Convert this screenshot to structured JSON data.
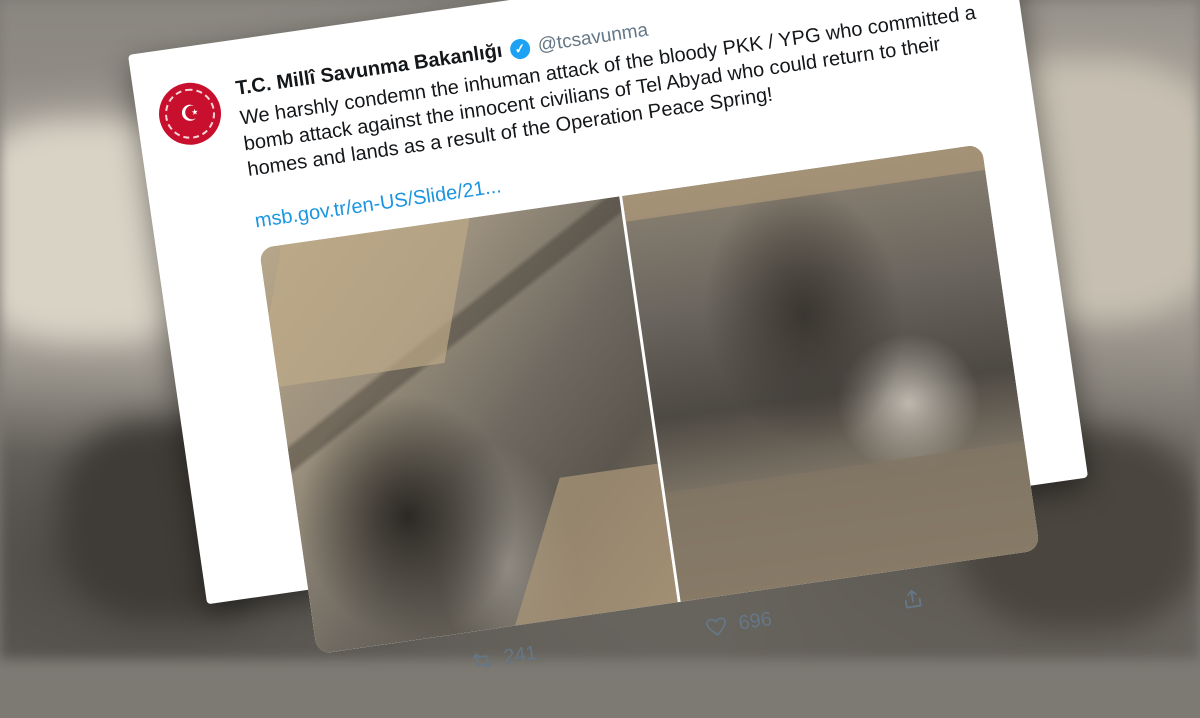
{
  "account": {
    "name": "T.C. Millî Savunma Bakanlığı",
    "handle": "@tcsavunma"
  },
  "tweet": {
    "text": "We harshly condemn the inhuman attack of the bloody PKK / YPG who committed a bomb attack against the innocent civilians of Tel Abyad who could return to their homes and lands as a result of the Operation Peace Spring!",
    "link": "msb.gov.tr/en-US/Slide/21..."
  },
  "actions": {
    "retweets": "241",
    "likes": "696"
  },
  "icons": [
    "verified-icon",
    "retweet-icon",
    "heart-icon",
    "share-icon"
  ],
  "colors": {
    "link": "#1b95e0",
    "verified": "#1da1f2",
    "avatar": "#c8102e"
  }
}
